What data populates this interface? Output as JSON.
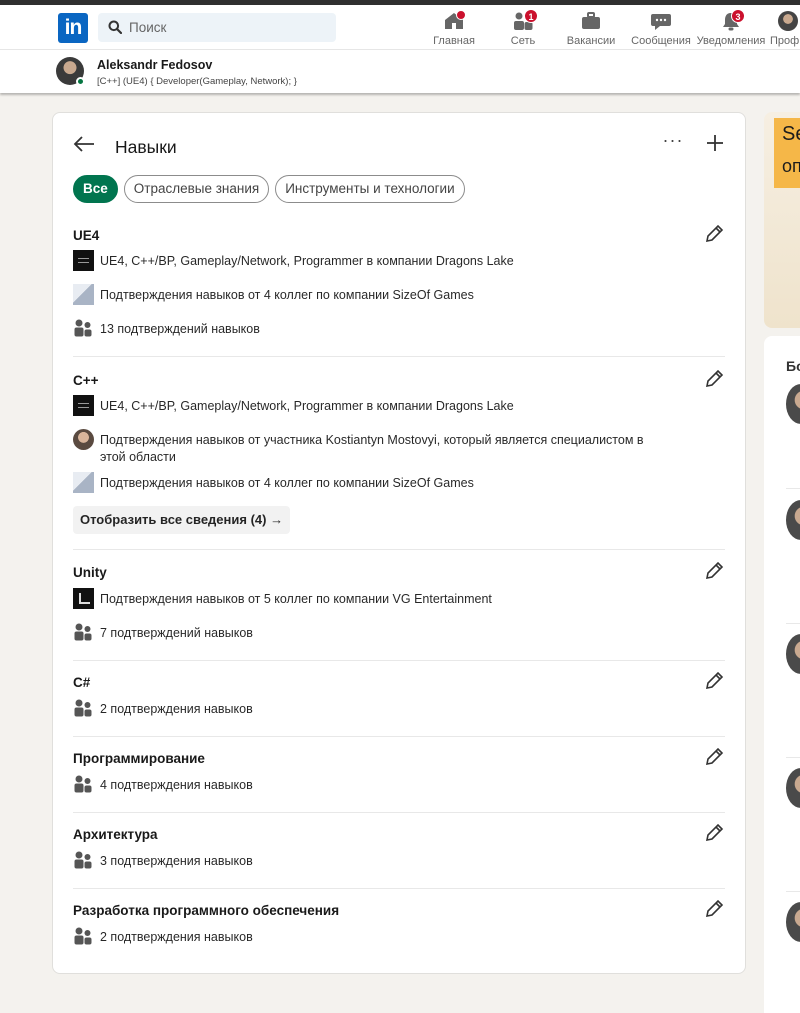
{
  "nav": {
    "logo": "in",
    "search_placeholder": "Поиск",
    "items": [
      {
        "label": "Главная",
        "badge": ""
      },
      {
        "label": "Сеть",
        "badge": "1"
      },
      {
        "label": "Вакансии",
        "badge": ""
      },
      {
        "label": "Сообщения",
        "badge": ""
      },
      {
        "label": "Уведомления",
        "badge": "3"
      },
      {
        "label": "Профи",
        "badge": ""
      }
    ]
  },
  "profile_bar": {
    "name": "Aleksandr Fedosov",
    "headline": "[C++] (UE4) { Developer(Gameplay, Network); }"
  },
  "skills_card": {
    "title": "Навыки",
    "more_label": "···",
    "filters": [
      {
        "label": "Все",
        "active": true
      },
      {
        "label": "Отраслевые знания",
        "active": false
      },
      {
        "label": "Инструменты и технологии",
        "active": false
      }
    ],
    "skills": [
      {
        "name": "UE4",
        "rows": [
          {
            "icon": "company-logo-dragons-lake",
            "text": "UE4, C++/BP, Gameplay/Network, Programmer в компании Dragons Lake"
          },
          {
            "icon": "company-logo-sizeof-games",
            "text": "Подтверждения навыков от 4 коллег по компании  SizeOf Games"
          },
          {
            "icon": "people-icon",
            "text": "13 подтверждений навыков"
          }
        ]
      },
      {
        "name": "C++",
        "rows": [
          {
            "icon": "company-logo-dragons-lake",
            "text": "UE4, C++/BP, Gameplay/Network, Programmer в компании Dragons Lake"
          },
          {
            "icon": "person-photo",
            "text": "Подтверждения навыков от участника Kostiantyn Mostovyi, который является специалистом в этой области"
          },
          {
            "icon": "company-logo-sizeof-games",
            "text": "Подтверждения навыков от 4 коллег по компании  SizeOf Games"
          }
        ],
        "show_all": "Отобразить все сведения (4) →"
      },
      {
        "name": "Unity",
        "rows": [
          {
            "icon": "company-logo-vg",
            "text": "Подтверждения навыков от 5 коллег по компании  VG Entertainment"
          },
          {
            "icon": "people-icon",
            "text": "7 подтверждений навыков"
          }
        ]
      },
      {
        "name": "C#",
        "rows": [
          {
            "icon": "people-icon",
            "text": "2 подтверждения навыков"
          }
        ]
      },
      {
        "name": "Программирование",
        "rows": [
          {
            "icon": "people-icon",
            "text": "4 подтверждения навыков"
          }
        ]
      },
      {
        "name": "Архитектура",
        "rows": [
          {
            "icon": "people-icon",
            "text": "3 подтверждения навыков"
          }
        ]
      },
      {
        "name": "Разработка программного обеспечения",
        "rows": [
          {
            "icon": "people-icon",
            "text": "2 подтверждения навыков"
          }
        ]
      }
    ]
  },
  "right_col": {
    "promo_text_top": "Se",
    "promo_text_bottom": "оп",
    "side_title": "Бо"
  },
  "colors": {
    "brand_blue": "#0a66c2",
    "active_pill": "#01754f",
    "badge_red": "#cb112d",
    "page_bg": "#f4f2ee"
  }
}
